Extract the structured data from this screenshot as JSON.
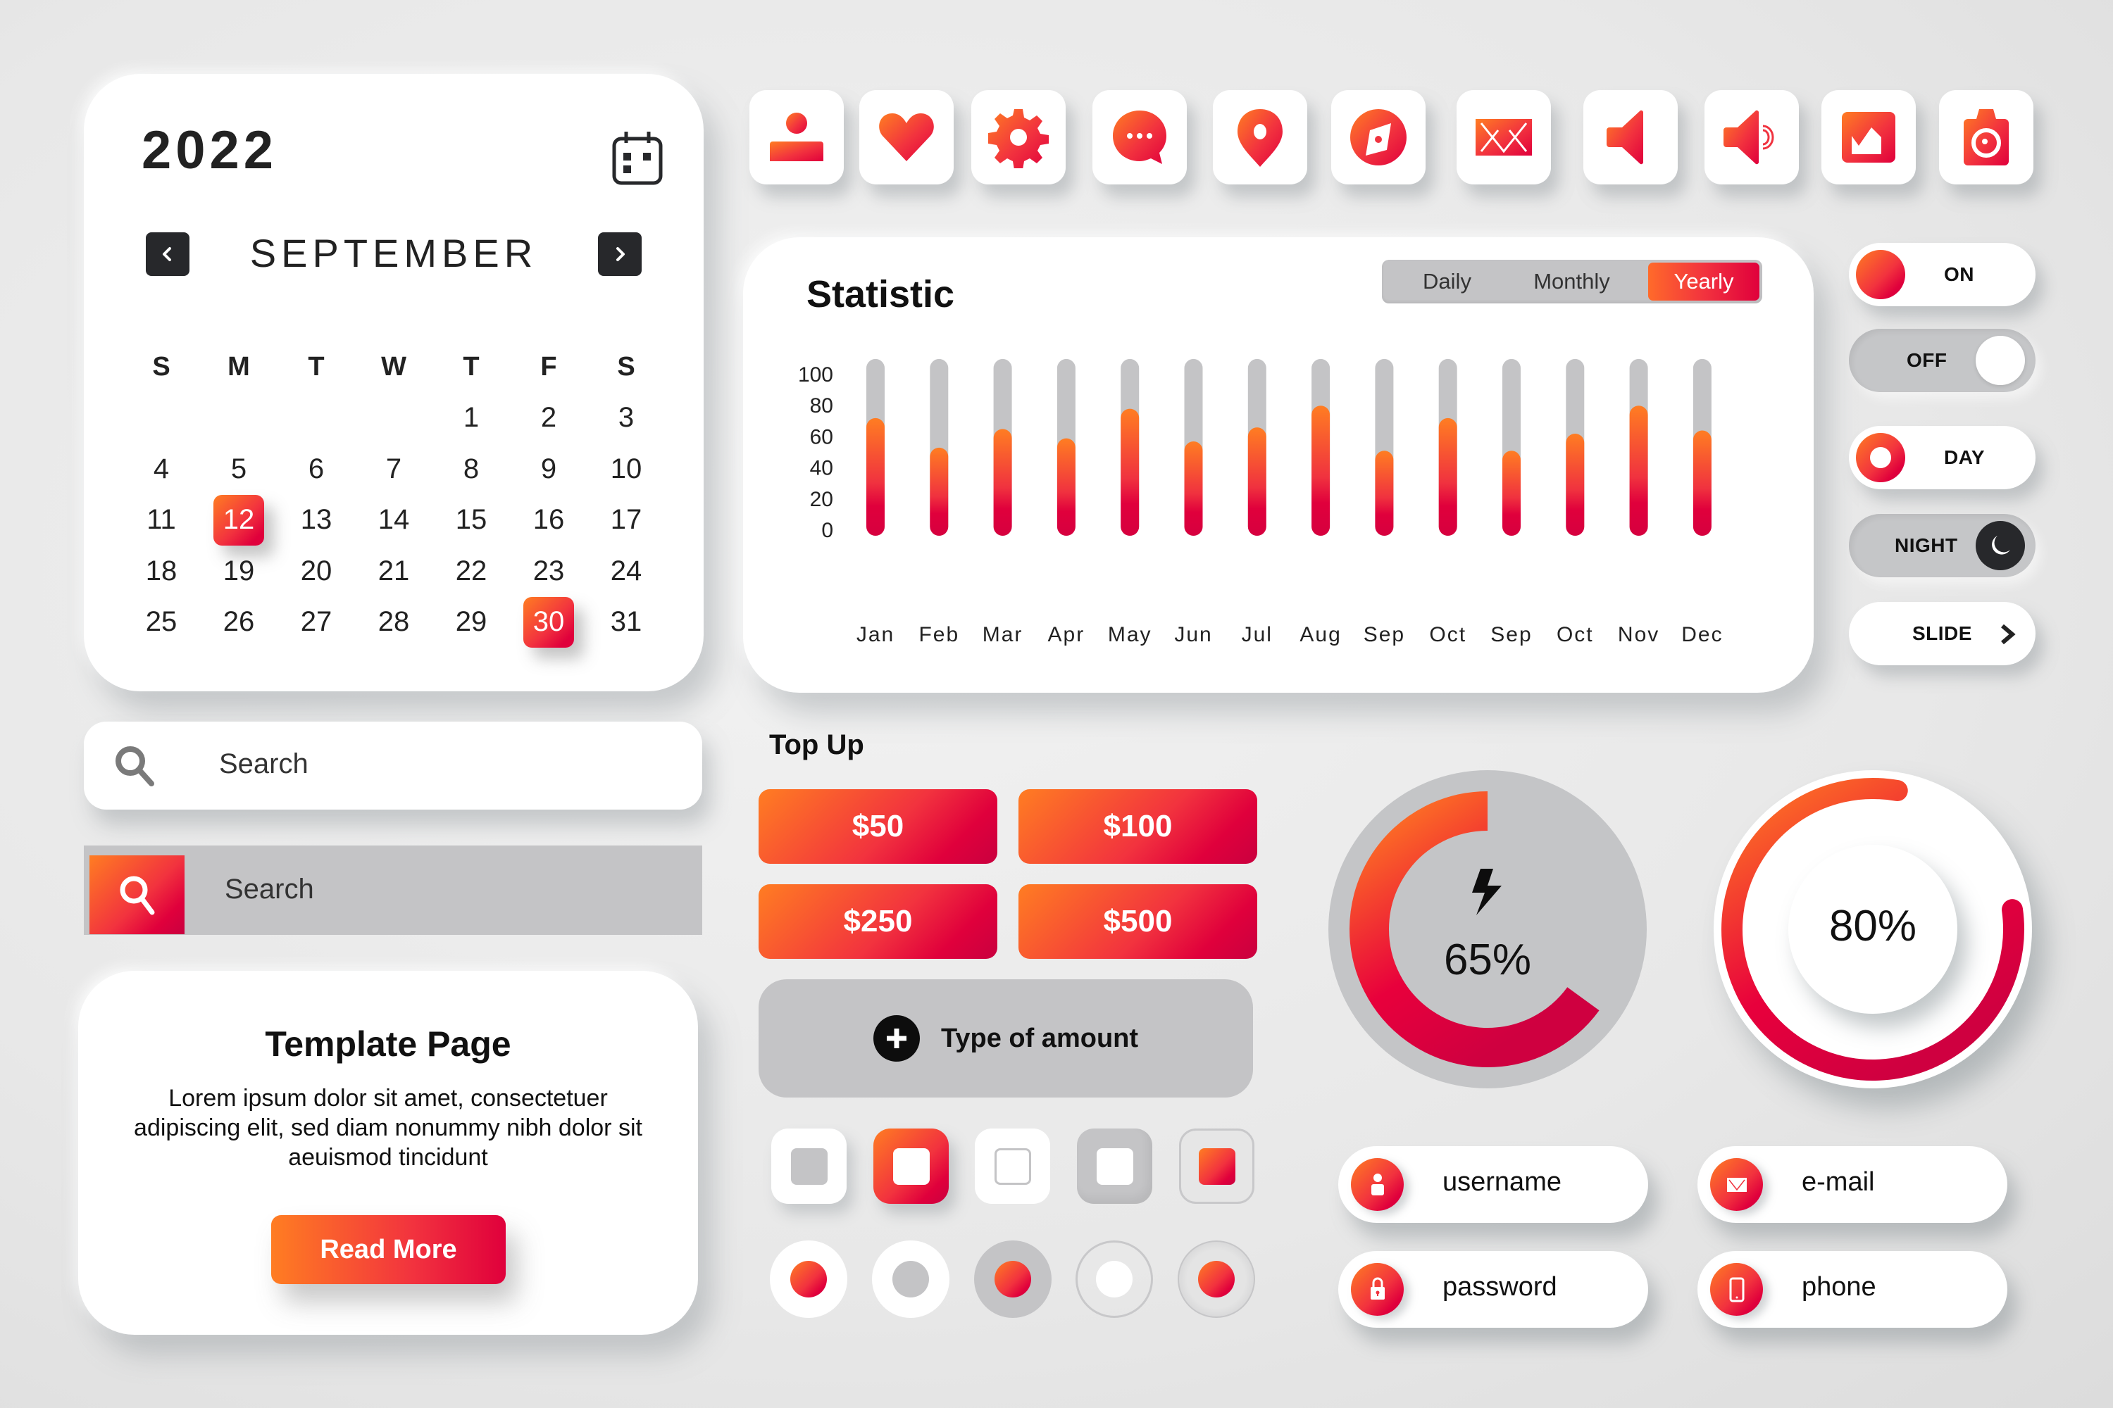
{
  "colors": {
    "accent_start": "#ff7d22",
    "accent_end": "#e0003c",
    "dark": "#27282b",
    "track_gray": "#c4c4c6",
    "background": "#ededed"
  },
  "calendar": {
    "year": "2022",
    "month": "SEPTEMBER",
    "prev_icon": "chevron-left-icon",
    "next_icon": "chevron-right-icon",
    "calendar_icon": "calendar-icon",
    "weekdays": [
      "S",
      "M",
      "T",
      "W",
      "T",
      "F",
      "S"
    ],
    "weeks": [
      [
        "",
        "",
        "",
        "",
        "1",
        "2",
        "3"
      ],
      [
        "4",
        "5",
        "6",
        "7",
        "8",
        "9",
        "10"
      ],
      [
        "11",
        "12",
        "13",
        "14",
        "15",
        "16",
        "17"
      ],
      [
        "18",
        "19",
        "20",
        "21",
        "22",
        "23",
        "24"
      ],
      [
        "25",
        "26",
        "27",
        "28",
        "29",
        "30",
        "31"
      ]
    ],
    "selected_days": [
      "12",
      "30"
    ]
  },
  "icon_bar": [
    {
      "name": "user-icon"
    },
    {
      "name": "heart-icon"
    },
    {
      "name": "gear-icon"
    },
    {
      "name": "chat-bubble-icon"
    },
    {
      "name": "location-pin-icon"
    },
    {
      "name": "compass-icon"
    },
    {
      "name": "mail-icon"
    },
    {
      "name": "speaker-mute-icon"
    },
    {
      "name": "speaker-volume-icon"
    },
    {
      "name": "image-icon"
    },
    {
      "name": "camera-icon"
    }
  ],
  "statistic": {
    "title": "Statistic",
    "periods": [
      "Daily",
      "Monthly",
      "Yearly"
    ],
    "active_period": "Yearly"
  },
  "chart_data": {
    "type": "bar",
    "title": "Statistic",
    "xlabel": "",
    "ylabel": "",
    "ylim": [
      0,
      100
    ],
    "yticks": [
      0,
      20,
      40,
      60,
      80,
      100
    ],
    "grid": false,
    "legend": "none",
    "categories": [
      "Jan",
      "Feb",
      "Mar",
      "Apr",
      "May",
      "Jun",
      "Jul",
      "Aug",
      "Sep",
      "Oct",
      "Sep",
      "Oct",
      "Nov",
      "Dec"
    ],
    "values": [
      72,
      53,
      65,
      59,
      78,
      57,
      66,
      80,
      51,
      72,
      51,
      62,
      80,
      64
    ],
    "track_max": 110
  },
  "toggles": [
    {
      "label": "ON",
      "state": "on"
    },
    {
      "label": "OFF",
      "state": "off"
    },
    {
      "label": "DAY",
      "state": "on"
    },
    {
      "label": "NIGHT",
      "state": "off",
      "icon": "moon-icon"
    },
    {
      "label": "SLIDE",
      "icon": "chevron-right-icon"
    }
  ],
  "search": {
    "bar1_placeholder": "Search",
    "bar2_placeholder": "Search"
  },
  "template_page": {
    "title": "Template Page",
    "body": "Lorem ipsum dolor sit amet, consectetuer adipiscing elit, sed diam nonummy nibh dolor sit aeuismod tincidunt",
    "button": "Read More"
  },
  "top_up": {
    "title": "Top Up",
    "amounts": [
      "$50",
      "$100",
      "$250",
      "$500"
    ],
    "custom_label": "Type of amount"
  },
  "checkboxes": [
    {
      "style": "white-gray"
    },
    {
      "style": "gradient-white",
      "checked": true
    },
    {
      "style": "white-outline"
    },
    {
      "style": "gray-white"
    },
    {
      "style": "outline-gradient",
      "checked": true
    }
  ],
  "radios": [
    {
      "style": "white-gradient",
      "checked": true
    },
    {
      "style": "white-gray"
    },
    {
      "style": "gray-gradient",
      "checked": true
    },
    {
      "style": "outline-white"
    },
    {
      "style": "inset-gradient",
      "checked": true
    }
  ],
  "gauges": [
    {
      "label": "65%",
      "value": 0.65,
      "icon": "lightning-icon"
    },
    {
      "label": "80%",
      "value": 0.8
    }
  ],
  "fields": [
    {
      "placeholder": "username",
      "icon": "user-icon"
    },
    {
      "placeholder": "e-mail",
      "icon": "mail-icon"
    },
    {
      "placeholder": "password",
      "icon": "lock-icon"
    },
    {
      "placeholder": "phone",
      "icon": "phone-icon"
    }
  ]
}
